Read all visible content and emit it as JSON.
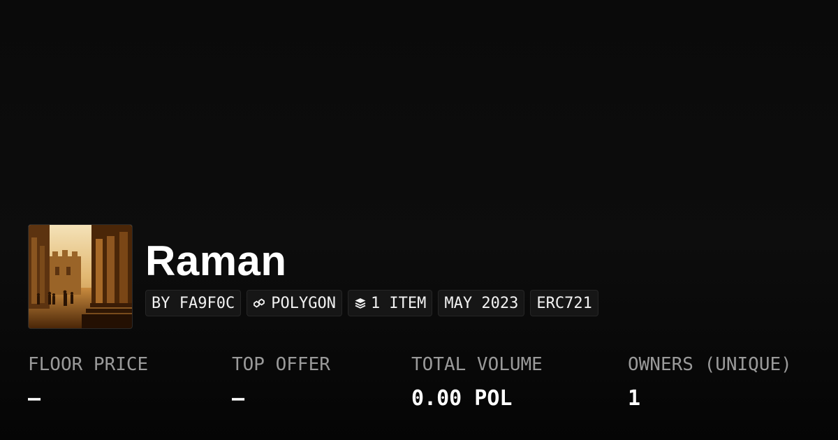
{
  "collection": {
    "name": "Raman",
    "chips": [
      {
        "label": "BY FA9F0C",
        "icon": ""
      },
      {
        "label": "POLYGON",
        "icon": "polygon-chain-icon"
      },
      {
        "label": "1 ITEM",
        "icon": "layers-icon"
      },
      {
        "label": "MAY 2023",
        "icon": ""
      },
      {
        "label": "ERC721",
        "icon": ""
      }
    ]
  },
  "stats": [
    {
      "label": "FLOOR PRICE",
      "value": "–"
    },
    {
      "label": "TOP OFFER",
      "value": "–"
    },
    {
      "label": "TOTAL VOLUME",
      "value": "0.00 POL"
    },
    {
      "label": "OWNERS (UNIQUE)",
      "value": "1"
    }
  ],
  "colors": {
    "background": "#0a0a0a",
    "chip_background": "#161616",
    "label_gray": "#9a9a9a",
    "text": "#ffffff"
  }
}
